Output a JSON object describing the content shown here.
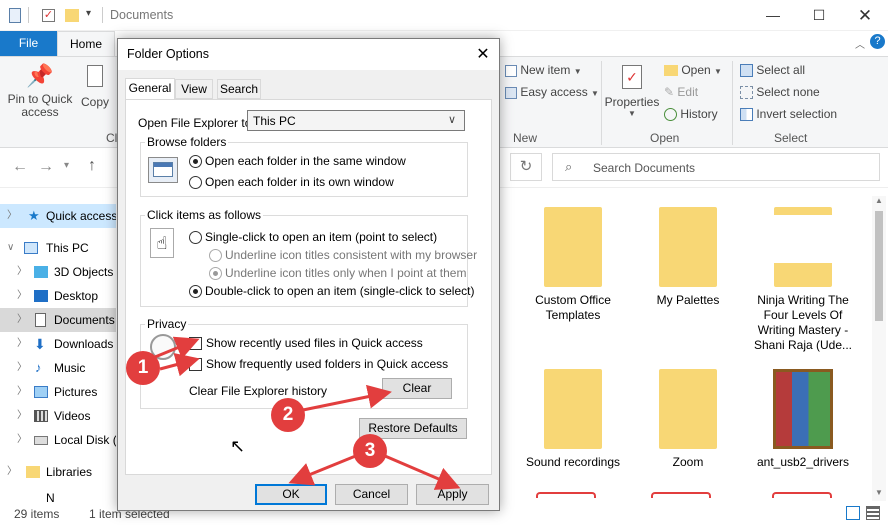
{
  "explorer": {
    "title": "Documents",
    "tabs": {
      "file": "File",
      "home": "Home"
    },
    "ribbon": {
      "pin_label": "Pin to Quick access",
      "copy_label": "Copy",
      "clip_group_cut": "Cl",
      "new_item": "New item",
      "easy_access": "Easy access",
      "new_group": "New",
      "properties": "Properties",
      "open": "Open",
      "edit": "Edit",
      "history": "History",
      "open_group": "Open",
      "select_all": "Select all",
      "select_none": "Select none",
      "invert_selection": "Invert selection",
      "select_group": "Select"
    },
    "search_placeholder": "Search Documents",
    "nav": [
      {
        "label": "Quick access",
        "expanded": false,
        "selected": true
      },
      {
        "label": "This PC",
        "expanded": true
      },
      {
        "label": "3D Objects"
      },
      {
        "label": "Desktop"
      },
      {
        "label": "Documents",
        "selected_gray": true
      },
      {
        "label": "Downloads"
      },
      {
        "label": "Music"
      },
      {
        "label": "Pictures"
      },
      {
        "label": "Videos"
      },
      {
        "label": "Local Disk (C"
      },
      {
        "label": "Libraries"
      },
      {
        "label": "N"
      }
    ],
    "files": [
      {
        "name": "Custom Office Templates"
      },
      {
        "name": "My Palettes"
      },
      {
        "name": "Ninja Writing The Four Levels Of Writing Mastery - Shani Raja (Ude..."
      },
      {
        "name": "Sound recordings"
      },
      {
        "name": "Zoom"
      },
      {
        "name": "ant_usb2_drivers"
      }
    ],
    "status": {
      "count": "29 items",
      "selected": "1 item selected"
    }
  },
  "dialog": {
    "title": "Folder Options",
    "tabs": [
      "General",
      "View",
      "Search"
    ],
    "open_to_label": "Open File Explorer to:",
    "open_to_value": "This PC",
    "browse_folders": {
      "label": "Browse folders",
      "opt1": "Open each folder in the same window",
      "opt2": "Open each folder in its own window"
    },
    "click_items": {
      "label": "Click items as follows",
      "single": "Single-click to open an item (point to select)",
      "underline1": "Underline icon titles consistent with my browser",
      "underline2": "Underline icon titles only when I point at them",
      "double": "Double-click to open an item (single-click to select)"
    },
    "privacy": {
      "label": "Privacy",
      "recent_files": "Show recently used files in Quick access",
      "frequent_folders": "Show frequently used folders in Quick access",
      "clear_label": "Clear File Explorer history",
      "clear_button": "Clear"
    },
    "restore_defaults": "Restore Defaults",
    "ok": "OK",
    "cancel": "Cancel",
    "apply": "Apply"
  },
  "annotations": {
    "step1": "1",
    "step2": "2",
    "step3": "3",
    "color": "#e23e3e"
  }
}
